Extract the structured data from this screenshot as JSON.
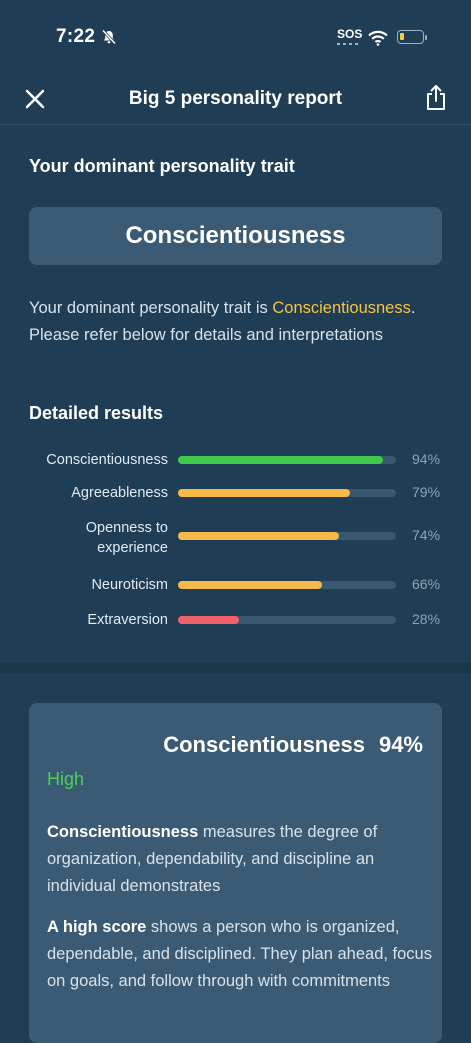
{
  "status_bar": {
    "time": "7:22",
    "sos": "SOS"
  },
  "nav": {
    "title": "Big 5 personality report"
  },
  "dominant": {
    "heading": "Your dominant personality trait",
    "trait": "Conscientiousness",
    "desc_prefix": "Your dominant personality trait is ",
    "desc_trait": "Conscientiousness",
    "desc_suffix": ". Please refer below for details and interpretations"
  },
  "results": {
    "heading": "Detailed results",
    "items": [
      {
        "label": "Conscientiousness",
        "pct": "94%",
        "value": 0.94,
        "color": "#3fc84a"
      },
      {
        "label": "Agreeableness",
        "pct": "79%",
        "value": 0.79,
        "color": "#f7b947"
      },
      {
        "label": "Openness to experience",
        "pct": "74%",
        "value": 0.74,
        "color": "#f7b947"
      },
      {
        "label": "Neuroticism",
        "pct": "66%",
        "value": 0.66,
        "color": "#f7b947"
      },
      {
        "label": "Extraversion",
        "pct": "28%",
        "value": 0.28,
        "color": "#f0606a"
      }
    ]
  },
  "detail": {
    "trait": "Conscientiousness",
    "pct": "94%",
    "level": "High",
    "measure_bold": "Conscientiousness",
    "measure_text": " measures the degree of organization, dependability, and discipline an individual demonstrates",
    "high_bold": "A high score",
    "high_text": " shows a person who is organized, dependable, and disciplined. They plan ahead, focus on goals, and follow through with commitments"
  }
}
